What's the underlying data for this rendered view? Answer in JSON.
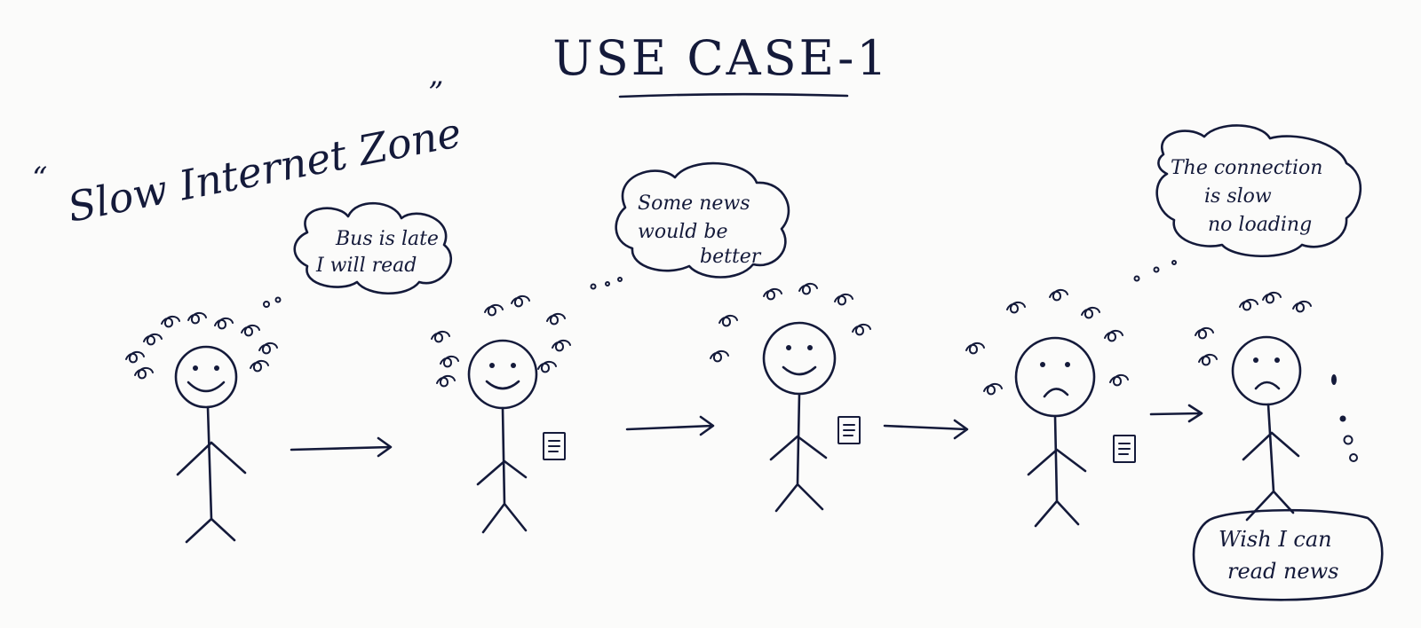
{
  "title": "USE CASE-1",
  "zone_label": {
    "open_quote": "“",
    "text": "Slow Internet Zone",
    "close_quote": "”"
  },
  "bubbles": [
    {
      "lines": [
        "Bus is late",
        "I will read"
      ]
    },
    {
      "lines": [
        "Some news",
        "would be",
        "better"
      ]
    },
    {
      "lines": [
        "The connection",
        "is slow",
        "no loading"
      ]
    },
    {
      "lines": [
        "Wish I can",
        "read news"
      ]
    }
  ],
  "figures": [
    {
      "mood": "happy",
      "has_phone": false
    },
    {
      "mood": "happy",
      "has_phone": true
    },
    {
      "mood": "happy",
      "has_phone": true
    },
    {
      "mood": "sad",
      "has_phone": true
    },
    {
      "mood": "sad",
      "has_phone": false
    }
  ],
  "colors": {
    "ink": "#141a3a",
    "paper": "#fbfbfa"
  }
}
